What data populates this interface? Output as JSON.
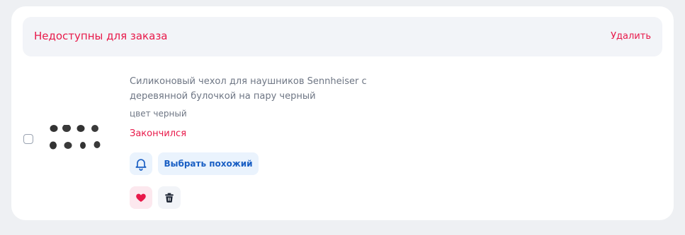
{
  "unavailable_section": {
    "title": "Недоступны для заказа",
    "remove_all_label": "Удалить"
  },
  "item": {
    "name": "Силиконовый чехол для наушников Sennheiser с деревянной булочкой на пару черный",
    "color": "цвет черный",
    "status": "Закончился",
    "selected": false,
    "thumbnail_icon": "earbud-covers-image",
    "actions": {
      "notify_icon": "bell-icon",
      "choose_similar_label": "Выбрать похожий",
      "favorite_icon": "heart-icon",
      "delete_icon": "trash-icon"
    }
  },
  "colors": {
    "accent_red": "#e8194a",
    "accent_blue": "#1a5fc4",
    "muted_text": "#6e7684",
    "page_bg": "#eef0f3",
    "card_bg": "#ffffff"
  }
}
